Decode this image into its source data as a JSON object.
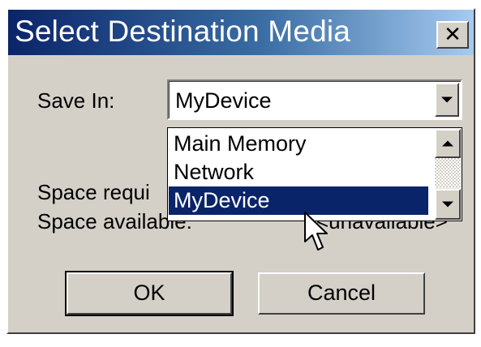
{
  "window": {
    "title": "Select Destination Media",
    "close_label": "✕"
  },
  "form": {
    "save_in_label": "Save In:",
    "save_in_value": "MyDevice",
    "space_required_label": "Space requi",
    "space_available_label": "Space available:",
    "space_available_value": "<unavailable>"
  },
  "dropdown": {
    "items": [
      {
        "label": "Main Memory",
        "selected": false
      },
      {
        "label": "Network",
        "selected": false
      },
      {
        "label": "MyDevice",
        "selected": true
      }
    ]
  },
  "buttons": {
    "ok_label": "OK",
    "cancel_label": "Cancel"
  },
  "colors": {
    "selection": "#0a246a",
    "title_gradient_start": "#0a246a",
    "title_gradient_end": "#a6caf0",
    "face": "#d4d0c8"
  },
  "icons": {
    "close": "close-icon",
    "combo_arrow": "chevron-down-icon",
    "scroll_up": "chevron-up-icon",
    "scroll_down": "chevron-down-icon",
    "cursor": "mouse-pointer-icon"
  }
}
